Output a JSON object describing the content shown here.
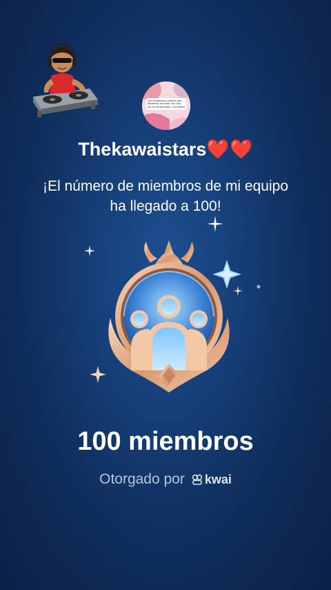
{
  "notification": {
    "avatar_caption": "Los verdaderos valores que debemos recordar hoy son los de hermandad y humildad",
    "username": "Thekawaistars",
    "username_emoji": "❤️❤️",
    "message": "¡El número de miembros de mi equipo ha llegado a 100!",
    "badge_title": "100 miembros",
    "awarded_by": "Otorgado por",
    "brand": "kwai"
  },
  "colors": {
    "background": "#16407a",
    "badge_gold": "#e7b28f",
    "badge_blue": "#5ea6e8",
    "text_muted": "#b7c5d9"
  },
  "icons": [
    "dj-sticker",
    "sparkle-icon",
    "members-badge-icon",
    "kwai-logo-icon"
  ]
}
